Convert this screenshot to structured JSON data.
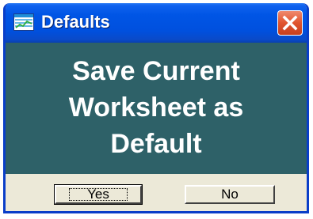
{
  "window": {
    "title": "Defaults",
    "title_icon": "worksheet-icon",
    "close_icon": "close-icon",
    "colors": {
      "title_bar": "#0055e5",
      "content_bg": "#2e6168",
      "close_button": "#e0542e"
    }
  },
  "message": {
    "line1": "Save Current",
    "line2": "Worksheet as",
    "line3": "Default"
  },
  "buttons": {
    "yes_label": "Yes",
    "no_label": "No"
  }
}
